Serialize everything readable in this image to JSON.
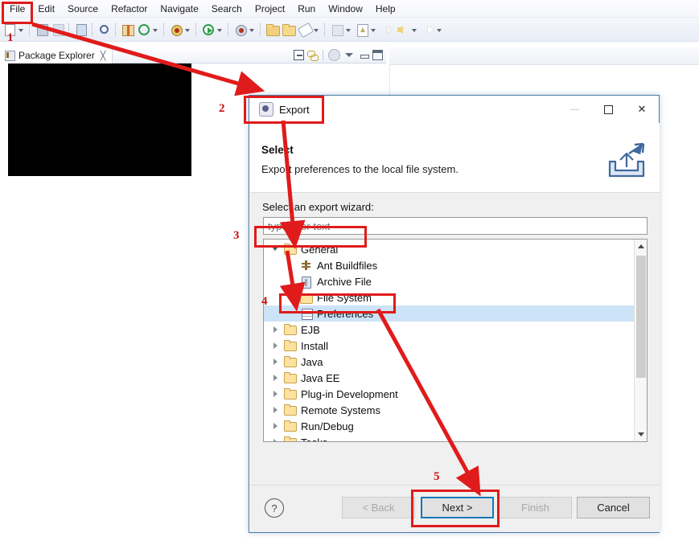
{
  "ide": {
    "menubar": [
      {
        "label": "File",
        "mnemonic": "F"
      },
      {
        "label": "Edit",
        "mnemonic": "E"
      },
      {
        "label": "Source",
        "mnemonic": "S"
      },
      {
        "label": "Refactor",
        "mnemonic": "t"
      },
      {
        "label": "Navigate",
        "mnemonic": "N"
      },
      {
        "label": "Search",
        "mnemonic": "a"
      },
      {
        "label": "Project",
        "mnemonic": "P"
      },
      {
        "label": "Run",
        "mnemonic": "R"
      },
      {
        "label": "Window",
        "mnemonic": "W"
      },
      {
        "label": "Help",
        "mnemonic": "H"
      }
    ],
    "toolbar_icons": [
      "new-wizard-icon",
      "save-icon",
      "save-all-icon",
      "open-type-icon",
      "toggle-breakpoint-icon",
      "new-package-icon",
      "run-external-tools-icon",
      "debug-icon",
      "run-icon",
      "run-server-icon",
      "open-folder-icon",
      "open-project-icon",
      "annotate-icon",
      "next-annotation-icon",
      "previous-edit-icon",
      "back-icon",
      "forward-icon"
    ],
    "package_explorer": {
      "tab_label": "Package Explorer",
      "close_label": "╳",
      "toolbar_icons": [
        "collapse-all-icon",
        "link-with-editor-icon",
        "view-filter-icon",
        "view-menu-icon",
        "minimize-icon",
        "maximize-icon"
      ]
    }
  },
  "dialog": {
    "title": "Export",
    "window_controls": {
      "minimize": "–",
      "maximize": "□",
      "close": "✕"
    },
    "header": {
      "heading": "Select",
      "description": "Export preferences to the local file system.",
      "icon": "export-wizard-icon"
    },
    "wizard_label": "Select an export wizard:",
    "filter": {
      "value": "",
      "placeholder": "type filter text"
    },
    "tree": [
      {
        "label": "General",
        "indent": 0,
        "twist": "open",
        "icon": "folder-open-icon",
        "selected": false
      },
      {
        "label": "Ant Buildfiles",
        "indent": 1,
        "twist": "none",
        "icon": "ant-buildfile-icon",
        "selected": false
      },
      {
        "label": "Archive File",
        "indent": 1,
        "twist": "none",
        "icon": "archive-file-icon",
        "selected": false
      },
      {
        "label": "File System",
        "indent": 1,
        "twist": "none",
        "icon": "folder-plain-icon",
        "selected": false
      },
      {
        "label": "Preferences",
        "indent": 1,
        "twist": "none",
        "icon": "preferences-icon",
        "selected": true
      },
      {
        "label": "EJB",
        "indent": 0,
        "twist": "closed",
        "icon": "folder-open-icon",
        "selected": false
      },
      {
        "label": "Install",
        "indent": 0,
        "twist": "closed",
        "icon": "folder-open-icon",
        "selected": false
      },
      {
        "label": "Java",
        "indent": 0,
        "twist": "closed",
        "icon": "folder-open-icon",
        "selected": false
      },
      {
        "label": "Java EE",
        "indent": 0,
        "twist": "closed",
        "icon": "folder-open-icon",
        "selected": false
      },
      {
        "label": "Plug-in Development",
        "indent": 0,
        "twist": "closed",
        "icon": "folder-open-icon",
        "selected": false
      },
      {
        "label": "Remote Systems",
        "indent": 0,
        "twist": "closed",
        "icon": "folder-open-icon",
        "selected": false
      },
      {
        "label": "Run/Debug",
        "indent": 0,
        "twist": "closed",
        "icon": "folder-open-icon",
        "selected": false
      },
      {
        "label": "Tasks",
        "indent": 0,
        "twist": "closed",
        "icon": "folder-open-icon",
        "selected": false
      }
    ],
    "scrollbar": {
      "up": "∧",
      "down": "∨"
    },
    "footer": {
      "help_label": "?",
      "back_label": "< Back",
      "next_label": "Next >",
      "finish_label": "Finish",
      "cancel_label": "Cancel"
    }
  },
  "annotations": {
    "colors": {
      "highlight": "#e01b1b",
      "number": "#cc0f14",
      "focus_ring": "#1577b8"
    },
    "steps": [
      {
        "number": "1",
        "target": "file-menu"
      },
      {
        "number": "2",
        "target": "export-dialog-title"
      },
      {
        "number": "3",
        "target": "tree-node-general"
      },
      {
        "number": "4",
        "target": "tree-node-preferences"
      },
      {
        "number": "5",
        "target": "next-button"
      }
    ]
  }
}
